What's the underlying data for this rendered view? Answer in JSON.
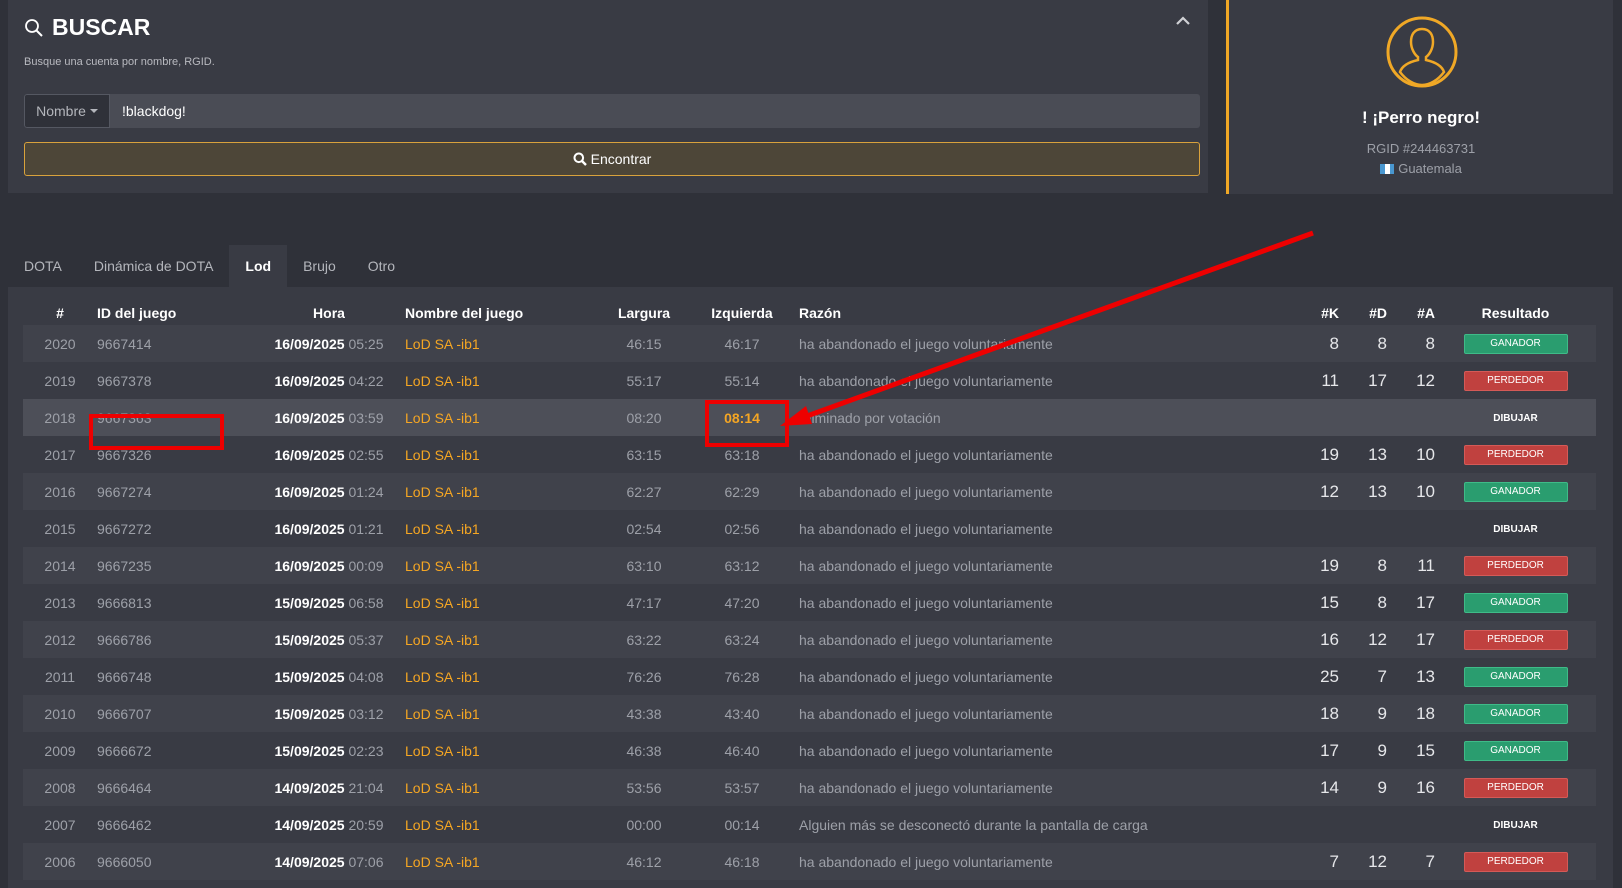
{
  "search": {
    "title": "BUSCAR",
    "description": "Busque una cuenta por nombre, RGID.",
    "type_selected": "Nombre",
    "query": "!blackdog!",
    "find_label": "Encontrar"
  },
  "profile": {
    "name": "! ¡Perro negro!",
    "rgid": "RGID #244463731",
    "country": "Guatemala",
    "accent_color": "#f0a826"
  },
  "tabs": [
    "DOTA",
    "Dinámica de DOTA",
    "Lod",
    "Brujo",
    "Otro"
  ],
  "active_tab": "Lod",
  "table": {
    "headers": {
      "num": "#",
      "game_id": "ID del juego",
      "time": "Hora",
      "game_name": "Nombre del juego",
      "length": "Largura",
      "left": "Izquierda",
      "reason": "Razón",
      "k": "#K",
      "d": "#D",
      "a": "#A",
      "result": "Resultado"
    },
    "rows": [
      {
        "num": "2020",
        "id": "9667414",
        "date": "16/09/2025",
        "time": "05:25",
        "game": "LoD SA -ib1",
        "length": "46:15",
        "left": "46:17",
        "reason": "ha abandonado el juego voluntariamente",
        "k": "8",
        "d": "8",
        "a": "8",
        "result": "GANADOR",
        "result_type": "win"
      },
      {
        "num": "2019",
        "id": "9667378",
        "date": "16/09/2025",
        "time": "04:22",
        "game": "LoD SA -ib1",
        "length": "55:17",
        "left": "55:14",
        "reason": "ha abandonado el juego voluntariamente",
        "k": "11",
        "d": "17",
        "a": "12",
        "result": "PERDEDOR",
        "result_type": "lose"
      },
      {
        "num": "2018",
        "id": "9667363",
        "date": "16/09/2025",
        "time": "03:59",
        "game": "LoD SA -ib1",
        "length": "08:20",
        "left": "08:14",
        "reason": "Eliminado por votación",
        "k": "",
        "d": "",
        "a": "",
        "result": "DIBUJAR",
        "result_type": "draw"
      },
      {
        "num": "2017",
        "id": "9667326",
        "date": "16/09/2025",
        "time": "02:55",
        "game": "LoD SA -ib1",
        "length": "63:15",
        "left": "63:18",
        "reason": "ha abandonado el juego voluntariamente",
        "k": "19",
        "d": "13",
        "a": "10",
        "result": "PERDEDOR",
        "result_type": "lose"
      },
      {
        "num": "2016",
        "id": "9667274",
        "date": "16/09/2025",
        "time": "01:24",
        "game": "LoD SA -ib1",
        "length": "62:27",
        "left": "62:29",
        "reason": "ha abandonado el juego voluntariamente",
        "k": "12",
        "d": "13",
        "a": "10",
        "result": "GANADOR",
        "result_type": "win"
      },
      {
        "num": "2015",
        "id": "9667272",
        "date": "16/09/2025",
        "time": "01:21",
        "game": "LoD SA -ib1",
        "length": "02:54",
        "left": "02:56",
        "reason": "ha abandonado el juego voluntariamente",
        "k": "",
        "d": "",
        "a": "",
        "result": "DIBUJAR",
        "result_type": "draw"
      },
      {
        "num": "2014",
        "id": "9667235",
        "date": "16/09/2025",
        "time": "00:09",
        "game": "LoD SA -ib1",
        "length": "63:10",
        "left": "63:12",
        "reason": "ha abandonado el juego voluntariamente",
        "k": "19",
        "d": "8",
        "a": "11",
        "result": "PERDEDOR",
        "result_type": "lose"
      },
      {
        "num": "2013",
        "id": "9666813",
        "date": "15/09/2025",
        "time": "06:58",
        "game": "LoD SA -ib1",
        "length": "47:17",
        "left": "47:20",
        "reason": "ha abandonado el juego voluntariamente",
        "k": "15",
        "d": "8",
        "a": "17",
        "result": "GANADOR",
        "result_type": "win"
      },
      {
        "num": "2012",
        "id": "9666786",
        "date": "15/09/2025",
        "time": "05:37",
        "game": "LoD SA -ib1",
        "length": "63:22",
        "left": "63:24",
        "reason": "ha abandonado el juego voluntariamente",
        "k": "16",
        "d": "12",
        "a": "17",
        "result": "PERDEDOR",
        "result_type": "lose"
      },
      {
        "num": "2011",
        "id": "9666748",
        "date": "15/09/2025",
        "time": "04:08",
        "game": "LoD SA -ib1",
        "length": "76:26",
        "left": "76:28",
        "reason": "ha abandonado el juego voluntariamente",
        "k": "25",
        "d": "7",
        "a": "13",
        "result": "GANADOR",
        "result_type": "win"
      },
      {
        "num": "2010",
        "id": "9666707",
        "date": "15/09/2025",
        "time": "03:12",
        "game": "LoD SA -ib1",
        "length": "43:38",
        "left": "43:40",
        "reason": "ha abandonado el juego voluntariamente",
        "k": "18",
        "d": "9",
        "a": "18",
        "result": "GANADOR",
        "result_type": "win"
      },
      {
        "num": "2009",
        "id": "9666672",
        "date": "15/09/2025",
        "time": "02:23",
        "game": "LoD SA -ib1",
        "length": "46:38",
        "left": "46:40",
        "reason": "ha abandonado el juego voluntariamente",
        "k": "17",
        "d": "9",
        "a": "15",
        "result": "GANADOR",
        "result_type": "win"
      },
      {
        "num": "2008",
        "id": "9666464",
        "date": "14/09/2025",
        "time": "21:04",
        "game": "LoD SA -ib1",
        "length": "53:56",
        "left": "53:57",
        "reason": "ha abandonado el juego voluntariamente",
        "k": "14",
        "d": "9",
        "a": "16",
        "result": "PERDEDOR",
        "result_type": "lose"
      },
      {
        "num": "2007",
        "id": "9666462",
        "date": "14/09/2025",
        "time": "20:59",
        "game": "LoD SA -ib1",
        "length": "00:00",
        "left": "00:14",
        "reason": "Alguien más se desconectó durante la pantalla de carga",
        "k": "",
        "d": "",
        "a": "",
        "result": "DIBUJAR",
        "result_type": "draw"
      },
      {
        "num": "2006",
        "id": "9666050",
        "date": "14/09/2025",
        "time": "07:06",
        "game": "LoD SA -ib1",
        "length": "46:12",
        "left": "46:18",
        "reason": "ha abandonado el juego voluntariamente",
        "k": "7",
        "d": "12",
        "a": "7",
        "result": "PERDEDOR",
        "result_type": "lose"
      }
    ]
  },
  "highlighted_row": "2018",
  "colors": {
    "accent": "#f5a623",
    "win": "#2a9d6f",
    "lose": "#c0413f",
    "annotation": "#ee0000"
  }
}
